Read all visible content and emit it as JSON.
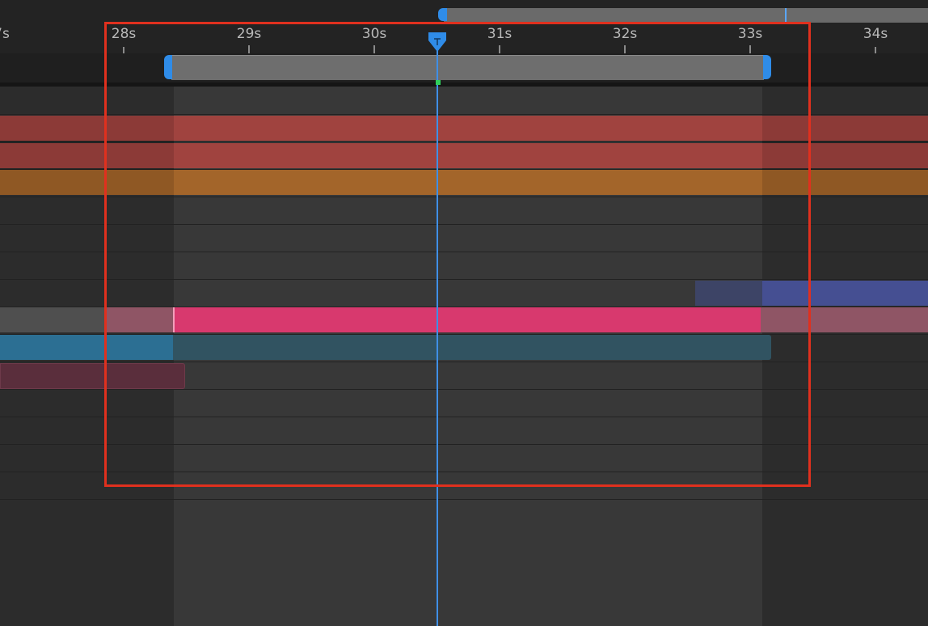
{
  "timeline": {
    "ruler": {
      "ticks": [
        {
          "label": "7s"
        },
        {
          "label": "28s"
        },
        {
          "label": "29s"
        },
        {
          "label": "30s"
        },
        {
          "label": "31s"
        },
        {
          "label": "32s"
        },
        {
          "label": "33s"
        },
        {
          "label": "34s"
        }
      ]
    },
    "current_time_indicator": {
      "icon": "playhead-icon"
    },
    "colors": {
      "accent_blue": "#2f8ce8",
      "playhead": "#3f8fe6",
      "layer_red": "#a0433f",
      "layer_orange": "#a3652a",
      "layer_pink": "#d8396e",
      "layer_navy": "#454f92",
      "layer_blue": "#2c6f93",
      "selection": "#e0301e"
    }
  }
}
